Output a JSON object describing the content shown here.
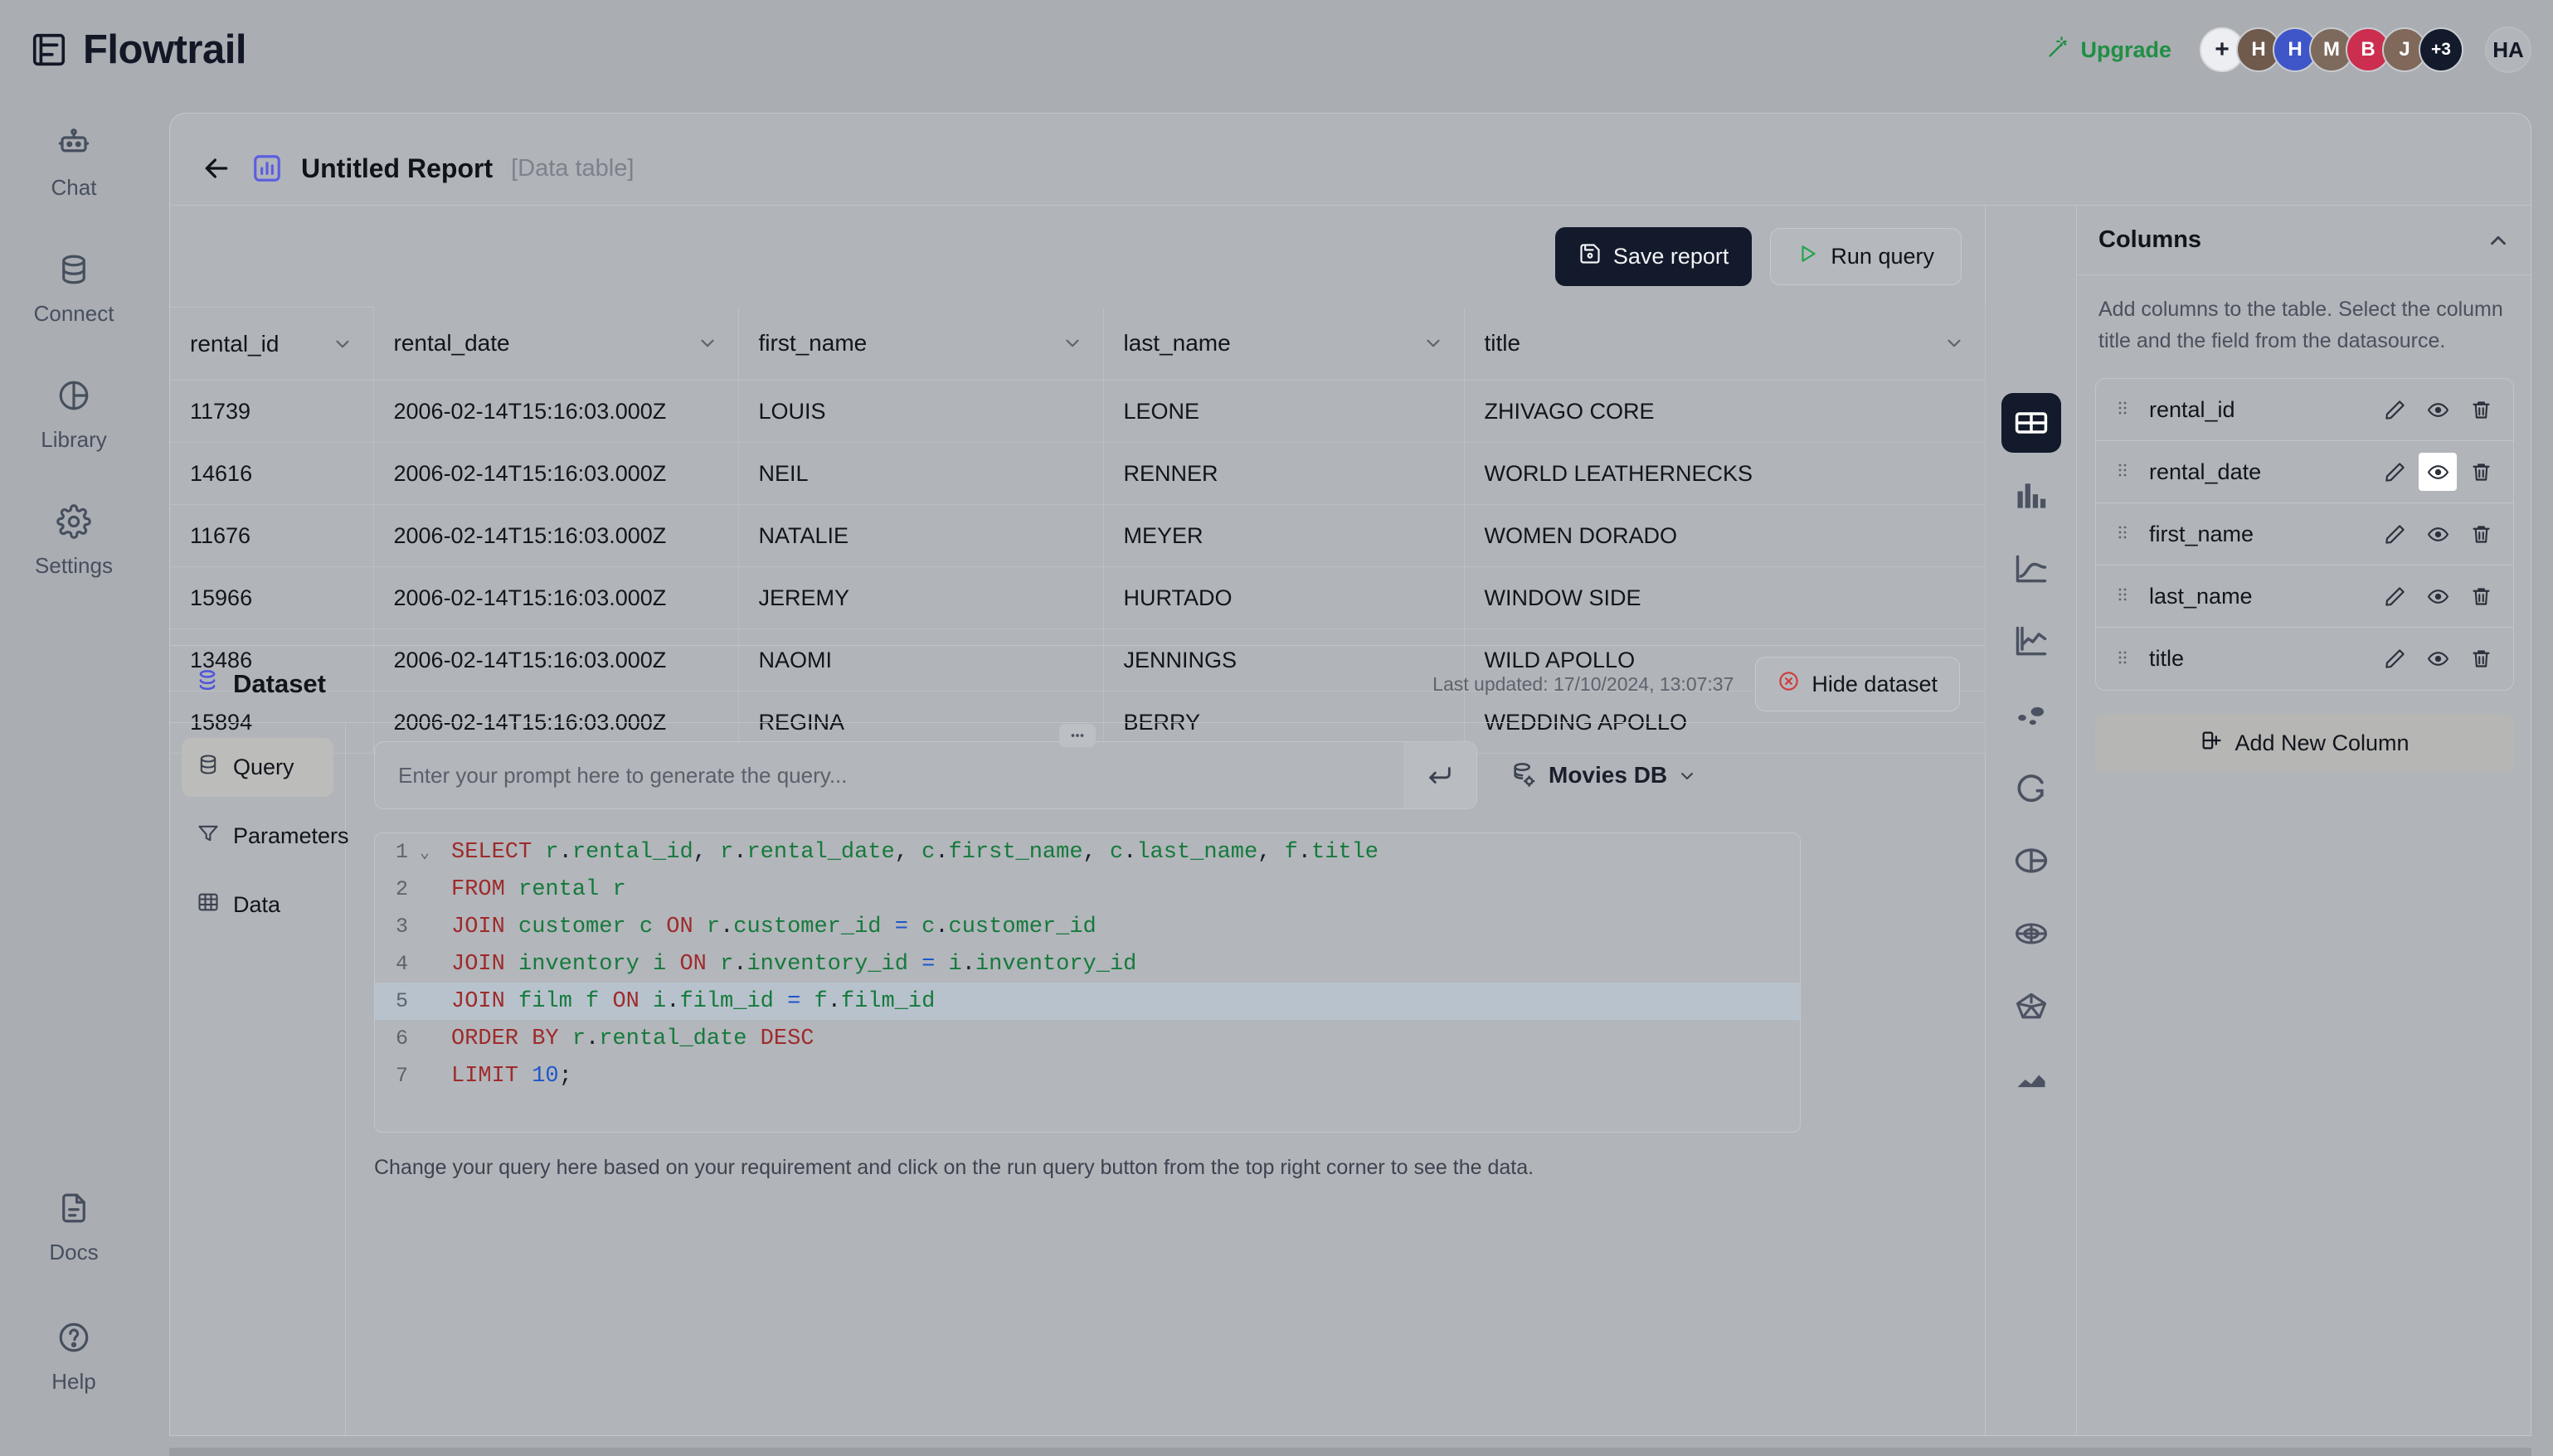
{
  "brand": {
    "name": "Flowtrail",
    "logo_icon": "flow-logo-icon"
  },
  "topbar": {
    "upgrade_label": "Upgrade",
    "upgrade_icon": "magic-wand-icon",
    "add_member_label": "+",
    "avatars": [
      {
        "initial": "H",
        "color": "#6f5a4c"
      },
      {
        "initial": "H",
        "color": "#3f56c9"
      },
      {
        "initial": "M",
        "color": "#7e6a5c"
      },
      {
        "initial": "B",
        "color": "#cc2e4f"
      },
      {
        "initial": "J",
        "color": "#80695a"
      }
    ],
    "overflow_label": "+3",
    "current_user_initials": "HA"
  },
  "rail": {
    "top_items": [
      {
        "label": "Chat",
        "icon": "robot-icon"
      },
      {
        "label": "Connect",
        "icon": "database-icon"
      },
      {
        "label": "Library",
        "icon": "pie-circle-icon"
      },
      {
        "label": "Settings",
        "icon": "gear-icon"
      }
    ],
    "bottom_items": [
      {
        "label": "Docs",
        "icon": "document-icon"
      },
      {
        "label": "Help",
        "icon": "question-circle-icon"
      }
    ]
  },
  "report": {
    "back_icon": "arrow-left-icon",
    "type_icon": "bar-chart-icon",
    "title": "Untitled Report",
    "kind": "[Data table]"
  },
  "toolbar": {
    "save_label": "Save report",
    "save_icon": "floppy-disk-icon",
    "run_label": "Run query",
    "run_icon": "play-icon"
  },
  "table": {
    "columns": [
      "rental_id",
      "rental_date",
      "first_name",
      "last_name",
      "title"
    ],
    "rows": [
      [
        "11739",
        "2006-02-14T15:16:03.000Z",
        "LOUIS",
        "LEONE",
        "ZHIVAGO CORE"
      ],
      [
        "14616",
        "2006-02-14T15:16:03.000Z",
        "NEIL",
        "RENNER",
        "WORLD LEATHERNECKS"
      ],
      [
        "11676",
        "2006-02-14T15:16:03.000Z",
        "NATALIE",
        "MEYER",
        "WOMEN DORADO"
      ],
      [
        "15966",
        "2006-02-14T15:16:03.000Z",
        "JEREMY",
        "HURTADO",
        "WINDOW SIDE"
      ],
      [
        "13486",
        "2006-02-14T15:16:03.000Z",
        "NAOMI",
        "JENNINGS",
        "WILD APOLLO"
      ],
      [
        "15894",
        "2006-02-14T15:16:03.000Z",
        "REGINA",
        "BERRY",
        "WEDDING APOLLO"
      ]
    ]
  },
  "viz_rail": [
    {
      "icon": "data-table-icon",
      "active": true
    },
    {
      "icon": "bar-chart-icon",
      "active": false
    },
    {
      "icon": "line-chart-icon",
      "active": false
    },
    {
      "icon": "area-line-chart-icon",
      "active": false
    },
    {
      "icon": "scatter-plot-icon",
      "active": false
    },
    {
      "icon": "donut-chart-icon",
      "active": false
    },
    {
      "icon": "pie-chart-icon",
      "active": false
    },
    {
      "icon": "radar-chart-icon",
      "active": false
    },
    {
      "icon": "polygon-chart-icon",
      "active": false
    },
    {
      "icon": "area-chart-icon",
      "active": false
    }
  ],
  "dataset": {
    "title": "Dataset",
    "title_icon": "stack-database-icon",
    "last_updated": "Last updated: 17/10/2024, 13:07:37",
    "hide_label": "Hide dataset",
    "hide_icon": "close-circle-icon",
    "tabs": [
      {
        "label": "Query",
        "icon": "database-icon",
        "active": true
      },
      {
        "label": "Parameters",
        "icon": "filter-icon",
        "active": false
      },
      {
        "label": "Data",
        "icon": "grid-table-icon",
        "active": false
      }
    ],
    "prompt_placeholder": "Enter your prompt here to generate the query...",
    "prompt_value": "",
    "send_icon": "enter-return-icon",
    "datasource_label": "Movies DB",
    "datasource_icon": "database-gear-icon",
    "datasource_chevron_icon": "chevron-down-icon",
    "helper_text": "Change your query here based on your requirement and click on the run query button from the top right corner to see the data.",
    "editor": {
      "active_line": 5,
      "lines": [
        {
          "n": "1",
          "fold": true,
          "tokens": [
            {
              "t": "SELECT",
              "c": "kw"
            },
            {
              "t": " ",
              "c": "pl"
            },
            {
              "t": "r",
              "c": "id"
            },
            {
              "t": ".",
              "c": "pl"
            },
            {
              "t": "rental_id",
              "c": "id"
            },
            {
              "t": ", ",
              "c": "pl"
            },
            {
              "t": "r",
              "c": "id"
            },
            {
              "t": ".",
              "c": "pl"
            },
            {
              "t": "rental_date",
              "c": "id"
            },
            {
              "t": ", ",
              "c": "pl"
            },
            {
              "t": "c",
              "c": "id"
            },
            {
              "t": ".",
              "c": "pl"
            },
            {
              "t": "first_name",
              "c": "id"
            },
            {
              "t": ", ",
              "c": "pl"
            },
            {
              "t": "c",
              "c": "id"
            },
            {
              "t": ".",
              "c": "pl"
            },
            {
              "t": "last_name",
              "c": "id"
            },
            {
              "t": ", ",
              "c": "pl"
            },
            {
              "t": "f",
              "c": "id"
            },
            {
              "t": ".",
              "c": "pl"
            },
            {
              "t": "title",
              "c": "id"
            }
          ]
        },
        {
          "n": "2",
          "fold": false,
          "tokens": [
            {
              "t": "FROM",
              "c": "kw"
            },
            {
              "t": " ",
              "c": "pl"
            },
            {
              "t": "rental",
              "c": "id"
            },
            {
              "t": " ",
              "c": "pl"
            },
            {
              "t": "r",
              "c": "id"
            }
          ]
        },
        {
          "n": "3",
          "fold": false,
          "tokens": [
            {
              "t": "JOIN",
              "c": "kw"
            },
            {
              "t": " ",
              "c": "pl"
            },
            {
              "t": "customer",
              "c": "id"
            },
            {
              "t": " ",
              "c": "pl"
            },
            {
              "t": "c",
              "c": "id"
            },
            {
              "t": " ",
              "c": "pl"
            },
            {
              "t": "ON",
              "c": "kw"
            },
            {
              "t": " ",
              "c": "pl"
            },
            {
              "t": "r",
              "c": "id"
            },
            {
              "t": ".",
              "c": "pl"
            },
            {
              "t": "customer_id",
              "c": "id"
            },
            {
              "t": " ",
              "c": "pl"
            },
            {
              "t": "=",
              "c": "op"
            },
            {
              "t": " ",
              "c": "pl"
            },
            {
              "t": "c",
              "c": "id"
            },
            {
              "t": ".",
              "c": "pl"
            },
            {
              "t": "customer_id",
              "c": "id"
            }
          ]
        },
        {
          "n": "4",
          "fold": false,
          "tokens": [
            {
              "t": "JOIN",
              "c": "kw"
            },
            {
              "t": " ",
              "c": "pl"
            },
            {
              "t": "inventory",
              "c": "id"
            },
            {
              "t": " ",
              "c": "pl"
            },
            {
              "t": "i",
              "c": "id"
            },
            {
              "t": " ",
              "c": "pl"
            },
            {
              "t": "ON",
              "c": "kw"
            },
            {
              "t": " ",
              "c": "pl"
            },
            {
              "t": "r",
              "c": "id"
            },
            {
              "t": ".",
              "c": "pl"
            },
            {
              "t": "inventory_id",
              "c": "id"
            },
            {
              "t": " ",
              "c": "pl"
            },
            {
              "t": "=",
              "c": "op"
            },
            {
              "t": " ",
              "c": "pl"
            },
            {
              "t": "i",
              "c": "id"
            },
            {
              "t": ".",
              "c": "pl"
            },
            {
              "t": "inventory_id",
              "c": "id"
            }
          ]
        },
        {
          "n": "5",
          "fold": false,
          "tokens": [
            {
              "t": "JOIN",
              "c": "kw"
            },
            {
              "t": " ",
              "c": "pl"
            },
            {
              "t": "film",
              "c": "id"
            },
            {
              "t": " ",
              "c": "pl"
            },
            {
              "t": "f",
              "c": "id"
            },
            {
              "t": " ",
              "c": "pl"
            },
            {
              "t": "ON",
              "c": "kw"
            },
            {
              "t": " ",
              "c": "pl"
            },
            {
              "t": "i",
              "c": "id"
            },
            {
              "t": ".",
              "c": "pl"
            },
            {
              "t": "film_id",
              "c": "id"
            },
            {
              "t": " ",
              "c": "pl"
            },
            {
              "t": "=",
              "c": "op"
            },
            {
              "t": " ",
              "c": "pl"
            },
            {
              "t": "f",
              "c": "id"
            },
            {
              "t": ".",
              "c": "pl"
            },
            {
              "t": "film_id",
              "c": "id"
            }
          ]
        },
        {
          "n": "6",
          "fold": false,
          "tokens": [
            {
              "t": "ORDER",
              "c": "kw"
            },
            {
              "t": " ",
              "c": "pl"
            },
            {
              "t": "BY",
              "c": "kw"
            },
            {
              "t": " ",
              "c": "pl"
            },
            {
              "t": "r",
              "c": "id"
            },
            {
              "t": ".",
              "c": "pl"
            },
            {
              "t": "rental_date",
              "c": "id"
            },
            {
              "t": " ",
              "c": "pl"
            },
            {
              "t": "DESC",
              "c": "kw"
            }
          ]
        },
        {
          "n": "7",
          "fold": false,
          "tokens": [
            {
              "t": "LIMIT",
              "c": "kw"
            },
            {
              "t": " ",
              "c": "pl"
            },
            {
              "t": "10",
              "c": "num"
            },
            {
              "t": ";",
              "c": "pl"
            }
          ]
        }
      ]
    }
  },
  "columns_panel": {
    "title": "Columns",
    "collapse_icon": "chevron-up-icon",
    "description": "Add columns to the table. Select the column title and the field from the datasource.",
    "items": [
      {
        "name": "rental_id",
        "hovered": false
      },
      {
        "name": "rental_date",
        "hovered": true
      },
      {
        "name": "first_name",
        "hovered": false
      },
      {
        "name": "last_name",
        "hovered": false
      },
      {
        "name": "title",
        "hovered": false
      }
    ],
    "row_icons": {
      "edit": "pencil-icon",
      "visibility": "eye-icon",
      "delete": "trash-icon",
      "drag": "drag-handle-icon"
    },
    "add_label": "Add New Column",
    "add_icon": "add-column-icon"
  },
  "colors": {
    "accent": "#5b5fe0",
    "success": "#1f8f43",
    "danger": "#d03b3b",
    "dark": "#121a2b"
  }
}
